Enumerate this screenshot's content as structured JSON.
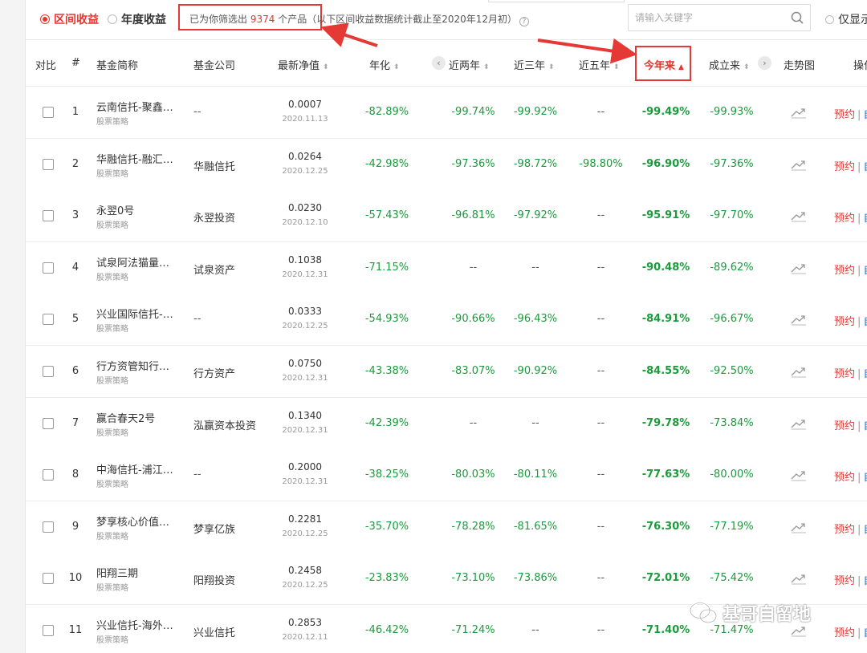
{
  "filters": {
    "interval_label": "区间收益",
    "annual_label": "年度收益",
    "summary_prefix": "已为你筛选出 ",
    "summary_count": "9374",
    "summary_suffix": " 个产品（以下区间收益数据统计截止至2020年12月初）",
    "search_placeholder": "请输入关键字",
    "only_show_label": "仅显示"
  },
  "headers": {
    "compare": "对比",
    "rank": "#",
    "name": "基金简称",
    "company": "基金公司",
    "nav": "最新净值",
    "annualized": "年化",
    "prev_nav": "‹",
    "two_year": "近两年",
    "three_year": "近三年",
    "five_year": "近五年",
    "ytd": "今年来",
    "since_inception": "成立来",
    "next_nav": "›",
    "trend": "走势图",
    "ops": "操作"
  },
  "actions": {
    "book": "预约",
    "sep": "|",
    "more": "自"
  },
  "rows": [
    {
      "rank": "1",
      "name": "云南信托-聚鑫…",
      "strategy": "股票策略",
      "company": "--",
      "nav": "0.0007",
      "date": "2020.11.13",
      "annualized": "-82.89%",
      "y2": "-99.74%",
      "y3": "-99.92%",
      "y5": "--",
      "ytd": "-99.49%",
      "since": "-99.93%"
    },
    {
      "rank": "2",
      "name": "华融信托-融汇…",
      "strategy": "股票策略",
      "company": "华融信托",
      "nav": "0.0264",
      "date": "2020.12.25",
      "annualized": "-42.98%",
      "y2": "-97.36%",
      "y3": "-98.72%",
      "y5": "-98.80%",
      "ytd": "-96.90%",
      "since": "-97.36%"
    },
    {
      "rank": "3",
      "name": "永翌0号",
      "strategy": "股票策略",
      "company": "永翌投资",
      "nav": "0.0230",
      "date": "2020.12.10",
      "annualized": "-57.43%",
      "y2": "-96.81%",
      "y3": "-97.92%",
      "y5": "--",
      "ytd": "-95.91%",
      "since": "-97.70%"
    },
    {
      "rank": "4",
      "name": "试泉阿法猫量…",
      "strategy": "股票策略",
      "company": "试泉资产",
      "nav": "0.1038",
      "date": "2020.12.31",
      "annualized": "-71.15%",
      "y2": "--",
      "y3": "--",
      "y5": "--",
      "ytd": "-90.48%",
      "since": "-89.62%"
    },
    {
      "rank": "5",
      "name": "兴业国际信托-…",
      "strategy": "股票策略",
      "company": "--",
      "nav": "0.0333",
      "date": "2020.12.25",
      "annualized": "-54.93%",
      "y2": "-90.66%",
      "y3": "-96.43%",
      "y5": "--",
      "ytd": "-84.91%",
      "since": "-96.67%"
    },
    {
      "rank": "6",
      "name": "行方资管知行…",
      "strategy": "股票策略",
      "company": "行方资产",
      "nav": "0.0750",
      "date": "2020.12.31",
      "annualized": "-43.38%",
      "y2": "-83.07%",
      "y3": "-90.92%",
      "y5": "--",
      "ytd": "-84.55%",
      "since": "-92.50%"
    },
    {
      "rank": "7",
      "name": "赢合春天2号",
      "strategy": "股票策略",
      "company": "泓赢资本投资",
      "nav": "0.1340",
      "date": "2020.12.31",
      "annualized": "-42.39%",
      "y2": "--",
      "y3": "--",
      "y5": "--",
      "ytd": "-79.78%",
      "since": "-73.84%"
    },
    {
      "rank": "8",
      "name": "中海信托-浦江…",
      "strategy": "股票策略",
      "company": "--",
      "nav": "0.2000",
      "date": "2020.12.31",
      "annualized": "-38.25%",
      "y2": "-80.03%",
      "y3": "-80.11%",
      "y5": "--",
      "ytd": "-77.63%",
      "since": "-80.00%"
    },
    {
      "rank": "9",
      "name": "梦享核心价值…",
      "strategy": "股票策略",
      "company": "梦享亿族",
      "nav": "0.2281",
      "date": "2020.12.25",
      "annualized": "-35.70%",
      "y2": "-78.28%",
      "y3": "-81.65%",
      "y5": "--",
      "ytd": "-76.30%",
      "since": "-77.19%"
    },
    {
      "rank": "10",
      "name": "阳翔三期",
      "strategy": "股票策略",
      "company": "阳翔投资",
      "nav": "0.2458",
      "date": "2020.12.25",
      "annualized": "-23.83%",
      "y2": "-73.10%",
      "y3": "-73.86%",
      "y5": "--",
      "ytd": "-72.01%",
      "since": "-75.42%"
    },
    {
      "rank": "11",
      "name": "兴业信托-海外…",
      "strategy": "股票策略",
      "company": "兴业信托",
      "nav": "0.2853",
      "date": "2020.12.11",
      "annualized": "-46.42%",
      "y2": "-71.24%",
      "y3": "--",
      "y5": "--",
      "ytd": "-71.40%",
      "since": "-71.47%"
    }
  ],
  "watermark": {
    "text": "基哥自留地"
  },
  "colors": {
    "accent_red": "#e6352f",
    "gain_green": "#1a9b3c",
    "link_blue": "#1f6fd1"
  }
}
